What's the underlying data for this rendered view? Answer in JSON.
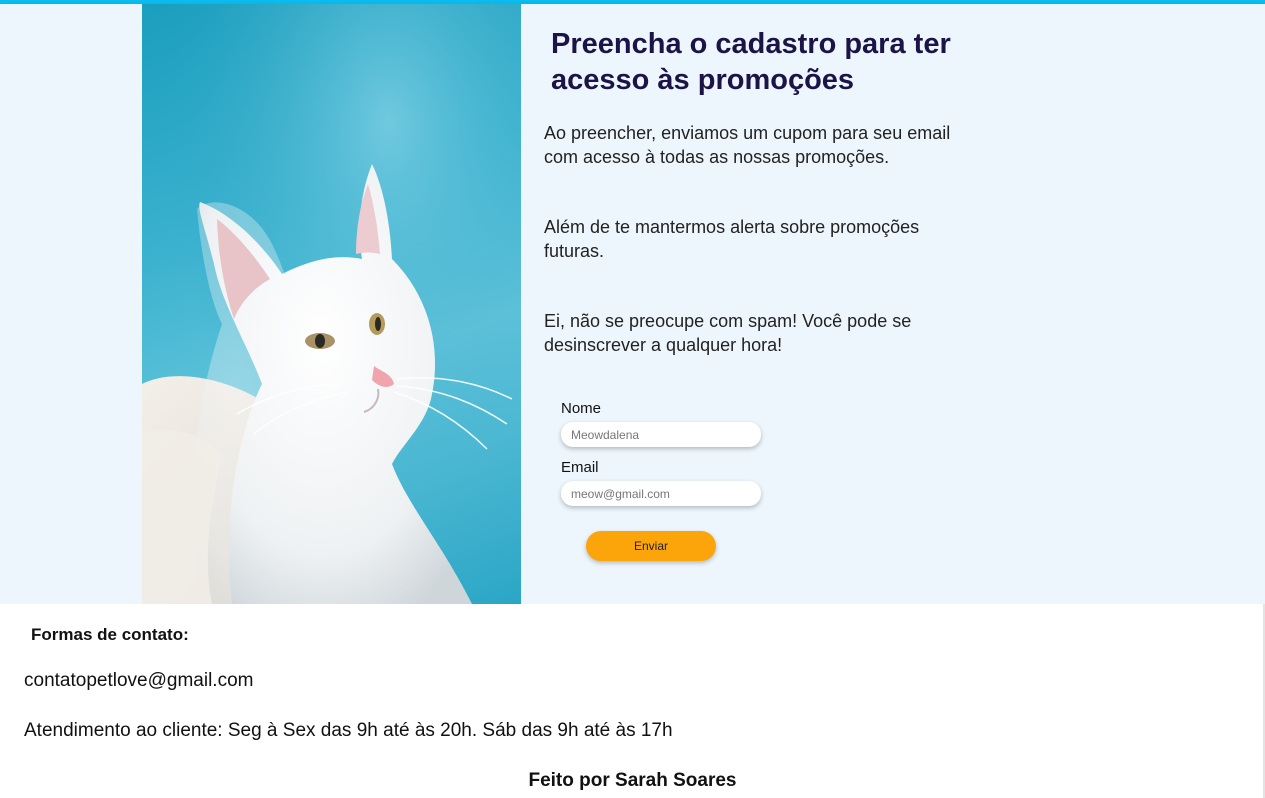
{
  "hero": {
    "title": "Preencha o cadastro para ter acesso às promoções",
    "paragraphs": [
      "Ao preencher, enviamos um cupom para seu email com acesso à todas as nossas promoções.",
      "Além de te mantermos alerta sobre promoções futuras.",
      "Ei, não se preocupe com spam! Você pode se desinscrever a qualquer hora!"
    ],
    "image": "white-cat-photo"
  },
  "form": {
    "name_label": "Nome",
    "name_placeholder": "Meowdalena",
    "email_label": "Email",
    "email_placeholder": "meow@gmail.com",
    "submit_label": "Enviar"
  },
  "footer": {
    "contact_heading": "Formas de contato:",
    "email": "contatopetlove@gmail.com",
    "hours": "Atendimento ao cliente: Seg à Sex das 9h até às 20h. Sáb das 9h até às 17h",
    "credit": "Feito por Sarah Soares"
  },
  "colors": {
    "accent_bar": "#0bbcf0",
    "hero_background": "#eef6fd",
    "title": "#1c1446",
    "button": "#fba50b"
  }
}
